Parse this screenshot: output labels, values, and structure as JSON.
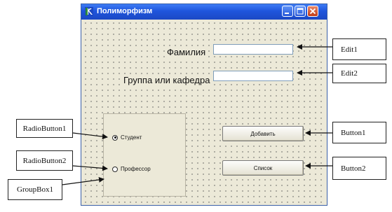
{
  "window": {
    "title": "Полиморфизм",
    "title_icon": "delphi-app-icon",
    "buttons": [
      "minimize-icon",
      "maximize-icon",
      "close-icon"
    ]
  },
  "form": {
    "surname_label": "Фамилия",
    "group_label": "Группа или кафедра",
    "edit1_value": "",
    "edit2_value": "",
    "radio1_label": "Студент",
    "radio1_checked": true,
    "radio2_label": "Профессор",
    "radio2_checked": false,
    "button1_label": "Добавить",
    "button2_label": "Список"
  },
  "callouts": {
    "edit1": "Edit1",
    "edit2": "Edit2",
    "button1": "Button1",
    "button2": "Button2",
    "radiobutton1": "RadioButton1",
    "radiobutton2": "RadioButton2",
    "groupbox1": "GroupBox1"
  },
  "colors": {
    "form_background": "#ece9d8",
    "titlebar": "#1f55dc",
    "close_button": "#c13b17"
  }
}
